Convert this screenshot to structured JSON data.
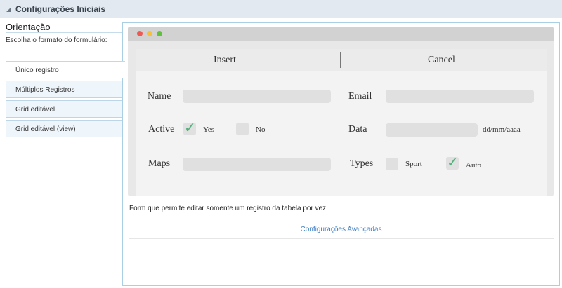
{
  "header": {
    "title": "Configurações Iniciais",
    "collapse_icon": "triangle-down-icon"
  },
  "orientation": {
    "title": "Orientação",
    "hint": "Escolha o formato do formulário:",
    "options": [
      "Único registro",
      "Múltiplos Registros",
      "Grid editável",
      "Grid editável (view)"
    ],
    "selected": "Único registro"
  },
  "preview": {
    "window_buttons": [
      "close-dot",
      "minimize-dot",
      "maximize-dot"
    ],
    "tabs": {
      "insert": "Insert",
      "cancel": "Cancel"
    },
    "labels": {
      "name": "Name",
      "email": "Email",
      "active": "Active",
      "data": "Data",
      "maps": "Maps",
      "types": "Types"
    },
    "options": {
      "yes": "Yes",
      "no": "No",
      "sport": "Sport",
      "auto": "Auto"
    },
    "date_format": "dd/mm/aaaa",
    "checked": {
      "yes": true,
      "no": false,
      "sport": false,
      "auto": true
    }
  },
  "description": "Form que permite editar somente um registro da tabela por vez.",
  "advanced_link": "Configurações Avançadas",
  "colors": {
    "header_bg": "#e3e9f0",
    "panel_border": "#a9cfe4",
    "link": "#3f7fc1",
    "check": "#4fb07a"
  }
}
